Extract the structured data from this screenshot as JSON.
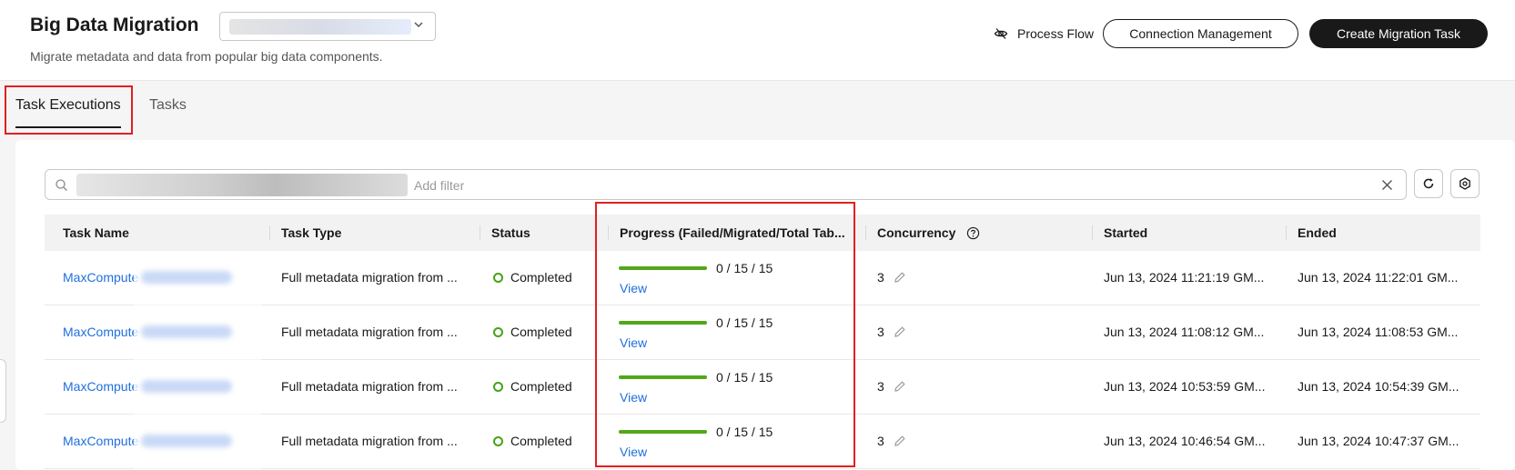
{
  "header": {
    "title": "Big Data Migration",
    "subtitle": "Migrate metadata and data from popular big data components.",
    "region_select_value": "",
    "process_flow_label": "Process Flow",
    "connection_management_label": "Connection Management",
    "create_task_label": "Create Migration Task"
  },
  "tabs": [
    {
      "label": "Task Executions",
      "active": true
    },
    {
      "label": "Tasks",
      "active": false
    }
  ],
  "search": {
    "placeholder": "Add filter",
    "value": ""
  },
  "table": {
    "columns": [
      "Task Name",
      "Task Type",
      "Status",
      "Progress (Failed/Migrated/Total Tab...",
      "Concurrency",
      "Started",
      "Ended"
    ],
    "rows": [
      {
        "name": "MaxCompute",
        "type": "Full metadata migration from ...",
        "status": "Completed",
        "progress": "0 / 15 / 15",
        "progress_fraction": 1.0,
        "view": "View",
        "concurrency": "3",
        "started": "Jun 13, 2024 11:21:19 GM...",
        "ended": "Jun 13, 2024 11:22:01 GM..."
      },
      {
        "name": "MaxCompute",
        "type": "Full metadata migration from ...",
        "status": "Completed",
        "progress": "0 / 15 / 15",
        "progress_fraction": 1.0,
        "view": "View",
        "concurrency": "3",
        "started": "Jun 13, 2024 11:08:12 GM...",
        "ended": "Jun 13, 2024 11:08:53 GM..."
      },
      {
        "name": "MaxCompute",
        "type": "Full metadata migration from ...",
        "status": "Completed",
        "progress": "0 / 15 / 15",
        "progress_fraction": 1.0,
        "view": "View",
        "concurrency": "3",
        "started": "Jun 13, 2024 10:53:59 GM...",
        "ended": "Jun 13, 2024 10:54:39 GM..."
      },
      {
        "name": "MaxCompute",
        "type": "Full metadata migration from ...",
        "status": "Completed",
        "progress": "0 / 15 / 15",
        "progress_fraction": 1.0,
        "view": "View",
        "concurrency": "3",
        "started": "Jun 13, 2024 10:46:54 GM...",
        "ended": "Jun 13, 2024 10:47:37 GM..."
      }
    ]
  },
  "colors": {
    "accent": "#191919",
    "link": "#1f6fe0",
    "success": "#52a719",
    "highlight": "#e02020"
  }
}
